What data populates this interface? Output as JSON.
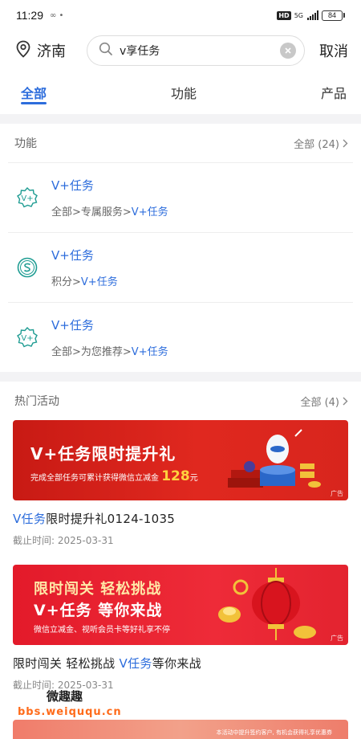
{
  "status": {
    "time": "11:29",
    "icons_left": "∞  •",
    "network": "5G",
    "battery": "84"
  },
  "header": {
    "city": "济南",
    "search_value": "v享任务",
    "cancel_label": "取消"
  },
  "tabs": [
    {
      "label": "全部",
      "active": true
    },
    {
      "label": "功能",
      "active": false
    },
    {
      "label": "产品",
      "active": false
    }
  ],
  "functions": {
    "title": "功能",
    "more": "全部 (24)",
    "items": [
      {
        "name": "V+任务",
        "path_prefix": "全部>专属服务>",
        "path_hl": "V+任务",
        "icon": "v-plus-badge-icon"
      },
      {
        "name": "V+任务",
        "path_prefix": "积分>",
        "path_hl": "V+任务",
        "icon": "s-circle-icon"
      },
      {
        "name": "V+任务",
        "path_prefix": "全部>为您推荐>",
        "path_hl": "V+任务",
        "icon": "v-plus-badge-icon"
      }
    ]
  },
  "activities": {
    "title": "热门活动",
    "more": "全部 (4)",
    "cards": [
      {
        "banner_title": "V+任务限时提升礼",
        "banner_sub": "完成全部任务可累计获得微信立减金",
        "banner_amount": "128",
        "banner_unit": "元",
        "ad": "广告",
        "title_hl": "V任务",
        "title_rest": "限时提升礼0124-1035",
        "date": "截止时间: 2025-03-31"
      },
      {
        "banner_line1": "限时闯关 轻松挑战",
        "banner_line2": "V+任务 等你来战",
        "banner_line3": "微信立减金、视听会员卡等好礼享不停",
        "ad": "广告",
        "title_pre": "限时闯关 轻松挑战 ",
        "title_hl": "V任务",
        "title_rest": "等你来战",
        "date": "截止时间: 2025-03-31"
      }
    ]
  },
  "watermark": {
    "brand": "微趣趣",
    "url": "bbs.weiququ.cn"
  },
  "bottom_banner_text": "本活动中提升签约客户, 有机会获得礼享优惠券",
  "colors": {
    "accent": "#2d6ddc",
    "banner_red": "#d8251d",
    "banner_gold": "#ffd23f"
  }
}
